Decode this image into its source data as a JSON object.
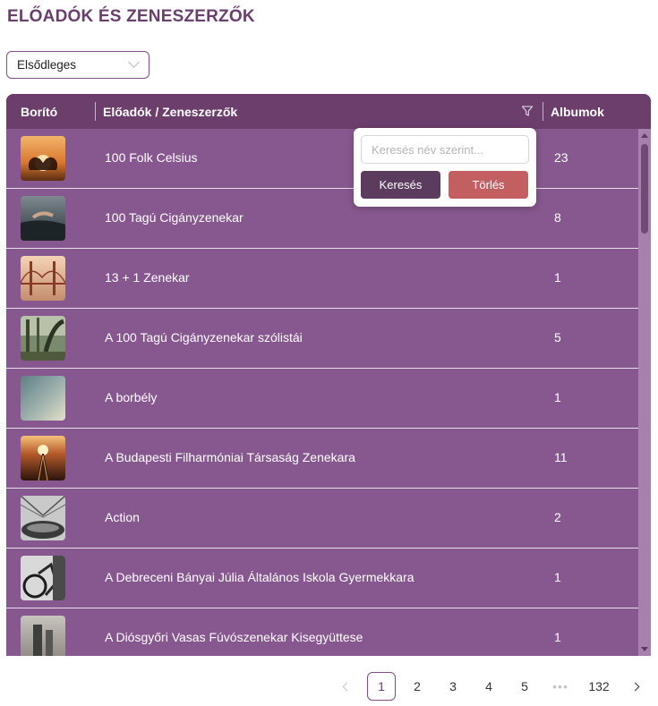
{
  "page": {
    "title": "ELŐADÓK ÉS ZENESZERZŐK"
  },
  "filter_select": {
    "value": "Elsődleges"
  },
  "table": {
    "columns": {
      "cover": "Borító",
      "name": "Előadók / Zeneszerzők",
      "count": "Albumok"
    },
    "rows": [
      {
        "name": "100 Folk Celsius",
        "count": "23",
        "thumb": "hands-heart-sunset"
      },
      {
        "name": "100 Tagú Cigányzenekar",
        "count": "8",
        "thumb": "swimmer"
      },
      {
        "name": "13 + 1 Zenekar",
        "count": "1",
        "thumb": "golden-gate-bridge"
      },
      {
        "name": "A 100 Tagú Cigányzenekar szólistái",
        "count": "5",
        "thumb": "forest-tree"
      },
      {
        "name": "A borbély",
        "count": "1",
        "thumb": "sky"
      },
      {
        "name": "A Budapesti Filharmóniai Társaság Zenekara",
        "count": "11",
        "thumb": "railway-sunset"
      },
      {
        "name": "Action",
        "count": "2",
        "thumb": "bridge-cables"
      },
      {
        "name": "A Debreceni Bányai Júlia Általános Iskola Gyermekkara",
        "count": "1",
        "thumb": "bicycle"
      },
      {
        "name": "A Diósgyőri Vasas Fúvószenekar Kisegyüttese",
        "count": "1",
        "thumb": "towers"
      }
    ]
  },
  "search_popup": {
    "placeholder": "Keresés név szerint...",
    "search_label": "Keresés",
    "clear_label": "Törlés"
  },
  "pagination": {
    "pages": [
      "1",
      "2",
      "3",
      "4",
      "5"
    ],
    "ellipsis": "•••",
    "last": "132",
    "current": "1"
  },
  "colors": {
    "header": "#6b3e6c",
    "row": "#87588f",
    "search_button": "#5b3b5e",
    "clear_button": "#c35f60",
    "title": "#6a3f6e"
  }
}
